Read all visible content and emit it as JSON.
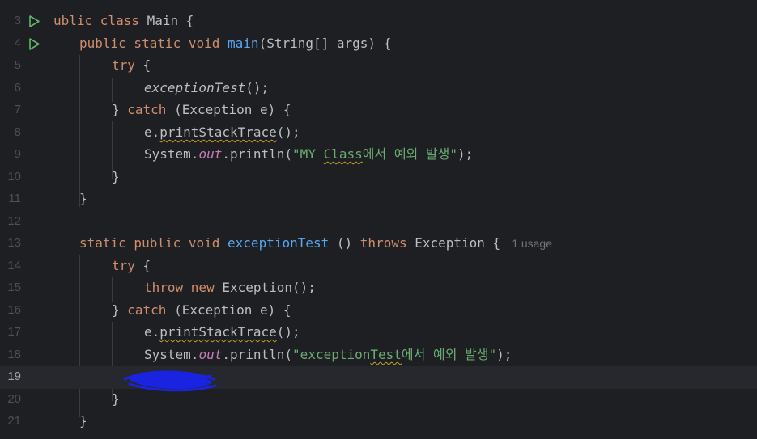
{
  "editor": {
    "lines": [
      {
        "num": "3",
        "run": true,
        "parts": {
          "kw1": "ublic class",
          "t1": " Main {"
        }
      },
      {
        "num": "4",
        "run": true,
        "parts": {
          "kw1": "public static void",
          "fn": "main",
          "t1": "(String[] args) {"
        }
      },
      {
        "num": "5",
        "parts": {
          "kw1": "try",
          "t1": " {"
        }
      },
      {
        "num": "6",
        "parts": {
          "it": "exceptionTest",
          "t1": "();"
        }
      },
      {
        "num": "7",
        "parts": {
          "t0": "} ",
          "kw1": "catch",
          "t1": " (Exception e) {"
        }
      },
      {
        "num": "8",
        "parts": {
          "t0": "e.",
          "sq": "printStackTrace",
          "t1": "();"
        }
      },
      {
        "num": "9",
        "parts": {
          "t0": "System.",
          "st": "out",
          "t1": ".println(",
          "s1": "\"MY ",
          "sq": "Class",
          "s2": "에서 예외 발생\"",
          "t2": ");"
        }
      },
      {
        "num": "10",
        "parts": {
          "t1": "}"
        }
      },
      {
        "num": "11",
        "parts": {
          "t1": "}"
        }
      },
      {
        "num": "12",
        "parts": {}
      },
      {
        "num": "13",
        "parts": {
          "kw1": "static public void",
          "fn": "exceptionTest",
          "t1": " () ",
          "kw2": "throws",
          "t2": " Exception {",
          "hint": "1 usage"
        }
      },
      {
        "num": "14",
        "parts": {
          "kw1": "try",
          "t1": " {"
        }
      },
      {
        "num": "15",
        "parts": {
          "kw1": "throw new",
          "t1": " Exception();"
        }
      },
      {
        "num": "16",
        "parts": {
          "t0": "} ",
          "kw1": "catch",
          "t1": " (Exception e) {"
        }
      },
      {
        "num": "17",
        "parts": {
          "t0": "e.",
          "sq": "printStackTrace",
          "t1": "();"
        }
      },
      {
        "num": "18",
        "parts": {
          "t0": "System.",
          "st": "out",
          "t1": ".println(",
          "s1": "\"exception",
          "sq": "Test",
          "s2": "에서 예외 발생\"",
          "t2": ");"
        }
      },
      {
        "num": "19",
        "parts": {}
      },
      {
        "num": "20",
        "parts": {
          "t1": "}"
        }
      },
      {
        "num": "21",
        "parts": {
          "t1": "}"
        }
      }
    ]
  },
  "colors": {
    "background": "#1e1f22",
    "keyword": "#cf8e6d",
    "function": "#56a8f5",
    "string": "#6aab73",
    "static_field": "#c77dbb",
    "run_icon": "#5fb865",
    "scribble": "#1a23e0"
  },
  "icons": {
    "run": "run-gutter-icon"
  }
}
